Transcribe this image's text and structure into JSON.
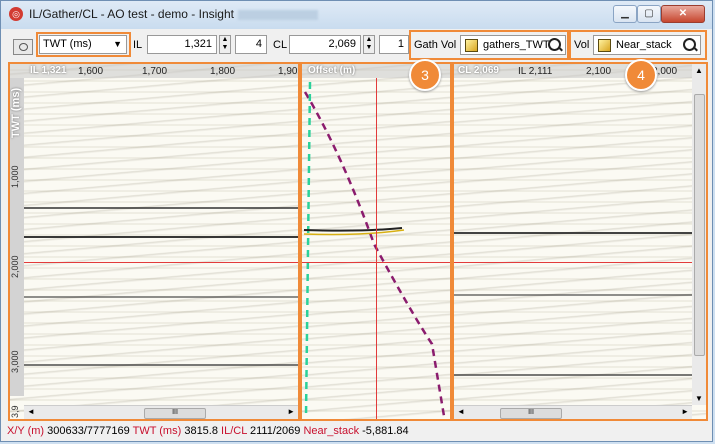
{
  "window": {
    "title": "IL/Gather/CL - AO test - demo - Insight"
  },
  "toolbar": {
    "domain_select": "TWT (ms)",
    "il_label": "IL",
    "il_value": "1,321",
    "il_step": "4",
    "cl_label": "CL",
    "cl_value": "2,069",
    "cl_step": "1",
    "gath_vol_label": "Gath Vol",
    "gath_vol_value": "gathers_TWT",
    "vol_label": "Vol",
    "vol_value": "Near_stack"
  },
  "callouts": [
    "3",
    "4"
  ],
  "panels": {
    "left": {
      "header": "IL 1,321",
      "ticks": [
        "1,600",
        "1,700",
        "1,800",
        "1,90"
      ],
      "yaxis_label": "TWT (ms)",
      "yticks": [
        "1,000",
        "2,000",
        "3,000",
        "3,9"
      ]
    },
    "middle": {
      "header": "Offset (m)"
    },
    "right": {
      "header": "CL 2,069",
      "ticks": [
        "IL 2,111",
        "2,100",
        "2,000"
      ]
    }
  },
  "statusbar": {
    "xy_label": "X/Y (m)",
    "xy_value": "300633/7777169",
    "twt_label": "TWT (ms)",
    "twt_value": "3815.8",
    "ilcl_label": "IL/CL",
    "ilcl_value": "2111/2069",
    "vol_label": "Near_stack",
    "vol_value": "-5,881.84"
  },
  "colors": {
    "accent": "#f08a38",
    "crosshair": "#e23b3b",
    "status_key": "#c8102e"
  }
}
